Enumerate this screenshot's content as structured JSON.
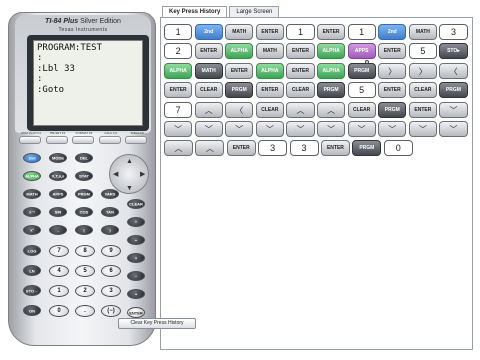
{
  "calculator": {
    "model": "TI-84 Plus",
    "edition": "Silver Edition",
    "brand": "Texas Instruments",
    "screen_lines": [
      "PROGRAM:TEST",
      ":",
      ":Lbl 33",
      ":",
      ":Goto"
    ],
    "function_keys": [
      "STAT PLOT F1",
      "TBLSET F2",
      "FORMAT F3",
      "CALC F4",
      "TABLE F5"
    ],
    "keys": {
      "second": "2nd",
      "mode": "MODE",
      "del": "DEL",
      "alpha": "ALPHA",
      "xt": "X,T,θ,n",
      "stat": "STAT",
      "math": "MATH",
      "apps": "APPS",
      "prgm": "PRGM",
      "vars": "VARS",
      "clear": "CLEAR",
      "x1": "x⁻¹",
      "sin": "SIN",
      "cos": "COS",
      "tan": "TAN",
      "pow": "^",
      "x2": "x²",
      "comma": ",",
      "lparen": "(",
      "rparen": ")",
      "div": "÷",
      "log": "LOG",
      "seven": "7",
      "eight": "8",
      "nine": "9",
      "mul": "×",
      "ln": "LN",
      "four": "4",
      "five": "5",
      "six": "6",
      "minus": "−",
      "sto": "STO→",
      "one": "1",
      "two": "2",
      "three": "3",
      "plus": "+",
      "on": "ON",
      "zero": "0",
      "dot": ".",
      "neg": "(−)",
      "enter": "ENTER"
    }
  },
  "tabs": {
    "history": "Key Press History",
    "large": "Large Screen"
  },
  "history": {
    "rows": [
      [
        {
          "t": "1",
          "s": "num"
        },
        {
          "t": "2nd",
          "s": "blue"
        },
        {
          "t": "MATH",
          "s": "gray"
        },
        {
          "t": "ENTER",
          "s": "gray"
        },
        {
          "t": "1",
          "s": "num"
        },
        {
          "t": "ENTER",
          "s": "gray"
        },
        {
          "t": "1",
          "s": "num"
        },
        {
          "t": "2nd",
          "s": "blue"
        },
        {
          "t": "MATH",
          "s": "gray"
        },
        {
          "t": "3",
          "s": "num"
        }
      ],
      [
        {
          "t": "2",
          "s": "num"
        },
        {
          "t": "ENTER",
          "s": "gray"
        },
        {
          "t": "ALPHA",
          "s": "green"
        },
        {
          "t": "MATH",
          "s": "gray"
        },
        {
          "t": "ENTER",
          "s": "gray"
        },
        {
          "t": "ALPHA",
          "s": "green"
        },
        {
          "t": "APPS",
          "s": "purple"
        },
        {
          "t": "ENTER",
          "s": "gray"
        },
        {
          "t": "5",
          "s": "num"
        },
        {
          "t": "STO▸",
          "s": "dark"
        }
      ],
      [
        {
          "t": "ALPHA",
          "s": "green"
        },
        {
          "t": "MATH",
          "s": "dark"
        },
        {
          "t": "ENTER",
          "s": "gray"
        },
        {
          "t": "ALPHA",
          "s": "green"
        },
        {
          "t": "ENTER",
          "s": "gray"
        },
        {
          "t": "ALPHA",
          "s": "green"
        },
        {
          "t": "PRGM",
          "s": "dark"
        },
        {
          "t": "〉",
          "s": "gray sym"
        },
        {
          "t": "〉",
          "s": "gray sym"
        },
        {
          "t": "〈",
          "s": "gray sym"
        }
      ],
      [
        {
          "t": "ENTER",
          "s": "gray"
        },
        {
          "t": "CLEAR",
          "s": "gray"
        },
        {
          "t": "PRGM",
          "s": "dark"
        },
        {
          "t": "ENTER",
          "s": "gray"
        },
        {
          "t": "CLEAR",
          "s": "gray"
        },
        {
          "t": "PRGM",
          "s": "dark"
        },
        {
          "t": "5",
          "s": "num"
        },
        {
          "t": "ENTER",
          "s": "gray"
        },
        {
          "t": "CLEAR",
          "s": "gray"
        },
        {
          "t": "PRGM",
          "s": "dark"
        }
      ],
      [
        {
          "t": "7",
          "s": "num"
        },
        {
          "t": "︿",
          "s": "gray sym"
        },
        {
          "t": "〈",
          "s": "gray sym"
        },
        {
          "t": "CLEAR",
          "s": "gray"
        },
        {
          "t": "︿",
          "s": "gray sym"
        },
        {
          "t": "︿",
          "s": "gray sym"
        },
        {
          "t": "CLEAR",
          "s": "gray"
        },
        {
          "t": "PRGM",
          "s": "dark"
        },
        {
          "t": "ENTER",
          "s": "gray"
        },
        {
          "t": "﹀",
          "s": "gray sym"
        }
      ],
      [
        {
          "t": "﹀",
          "s": "gray sym"
        },
        {
          "t": "﹀",
          "s": "gray sym"
        },
        {
          "t": "﹀",
          "s": "gray sym"
        },
        {
          "t": "﹀",
          "s": "gray sym"
        },
        {
          "t": "﹀",
          "s": "gray sym"
        },
        {
          "t": "﹀",
          "s": "gray sym"
        },
        {
          "t": "﹀",
          "s": "gray sym"
        },
        {
          "t": "﹀",
          "s": "gray sym"
        },
        {
          "t": "﹀",
          "s": "gray sym"
        },
        {
          "t": "﹀",
          "s": "gray sym"
        }
      ],
      [
        {
          "t": "︿",
          "s": "gray sym"
        },
        {
          "t": "︿",
          "s": "gray sym"
        },
        {
          "t": "ENTER",
          "s": "gray"
        },
        {
          "t": "3",
          "s": "num"
        },
        {
          "t": "3",
          "s": "num"
        },
        {
          "t": "ENTER",
          "s": "gray"
        },
        {
          "t": "PRGM",
          "s": "dark"
        },
        {
          "t": "0",
          "s": "num"
        }
      ]
    ]
  },
  "clear_history_label": "Clear Key Press History"
}
